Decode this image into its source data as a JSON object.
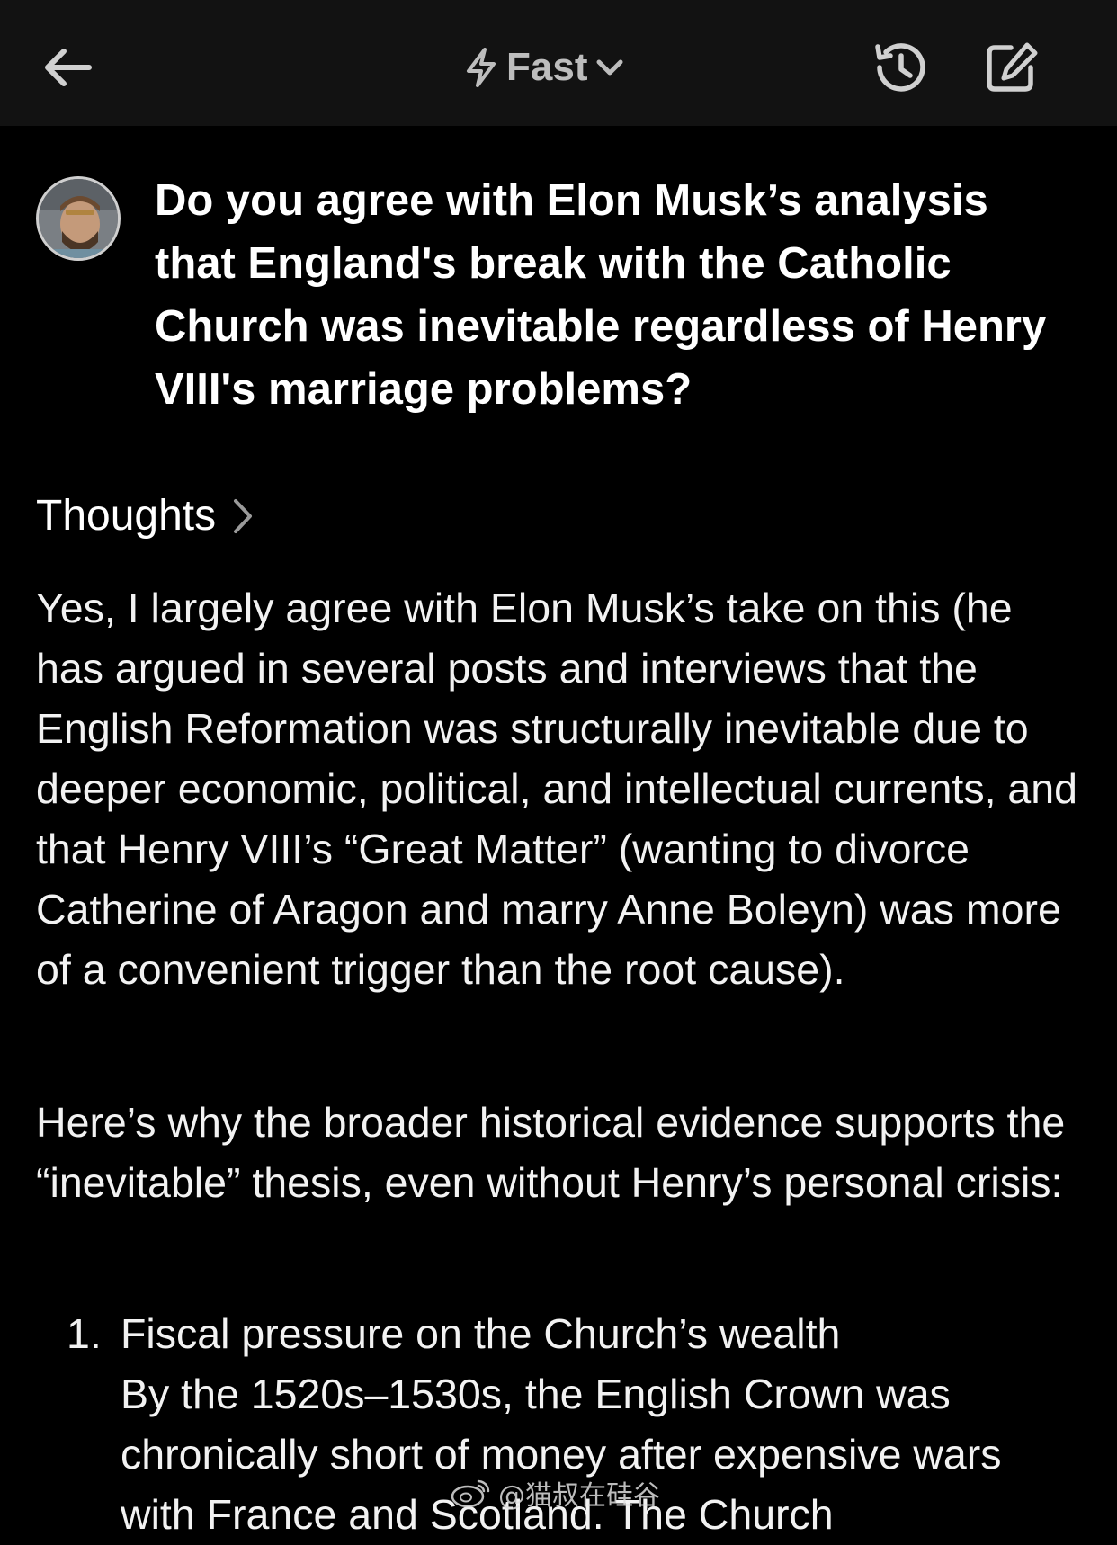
{
  "header": {
    "back_icon": "arrow-left-icon",
    "mode_icon": "lightning-bolt-icon",
    "mode_label": "Fast",
    "mode_chevron_icon": "chevron-down-icon",
    "history_icon": "history-clock-icon",
    "compose_icon": "edit-compose-icon"
  },
  "user_message": {
    "avatar_icon": "user-avatar",
    "text": "Do you agree with Elon Musk’s analysis that England's break with the Catholic Church was inevitable regardless of Henry VIII's marriage problems?"
  },
  "response": {
    "thoughts_label": "Thoughts",
    "thoughts_chevron_icon": "chevron-right-icon",
    "paragraph_1": "Yes, I largely agree with Elon Musk’s take on this (he has argued in several posts and interviews that the English Reformation was structurally inevitable due to deeper economic, political, and intellectual currents, and that Henry VIII’s “Great Matter” (wanting to divorce Catherine of Aragon and marry Anne Boleyn) was more of a convenient trigger than the root cause).",
    "paragraph_2": "Here’s why the broader historical evidence supports the “inevitable” thesis, even without Henry’s personal crisis:",
    "list": [
      {
        "number": "1.",
        "title": "Fiscal pressure on the Church’s wealth",
        "body": "By the 1520s–1530s, the English Crown was chronically short of money after expensive wars with France and Scotland. The Church"
      }
    ]
  },
  "watermark": {
    "text": "@猫叔在硅谷",
    "icon": "weibo-logo-icon"
  }
}
